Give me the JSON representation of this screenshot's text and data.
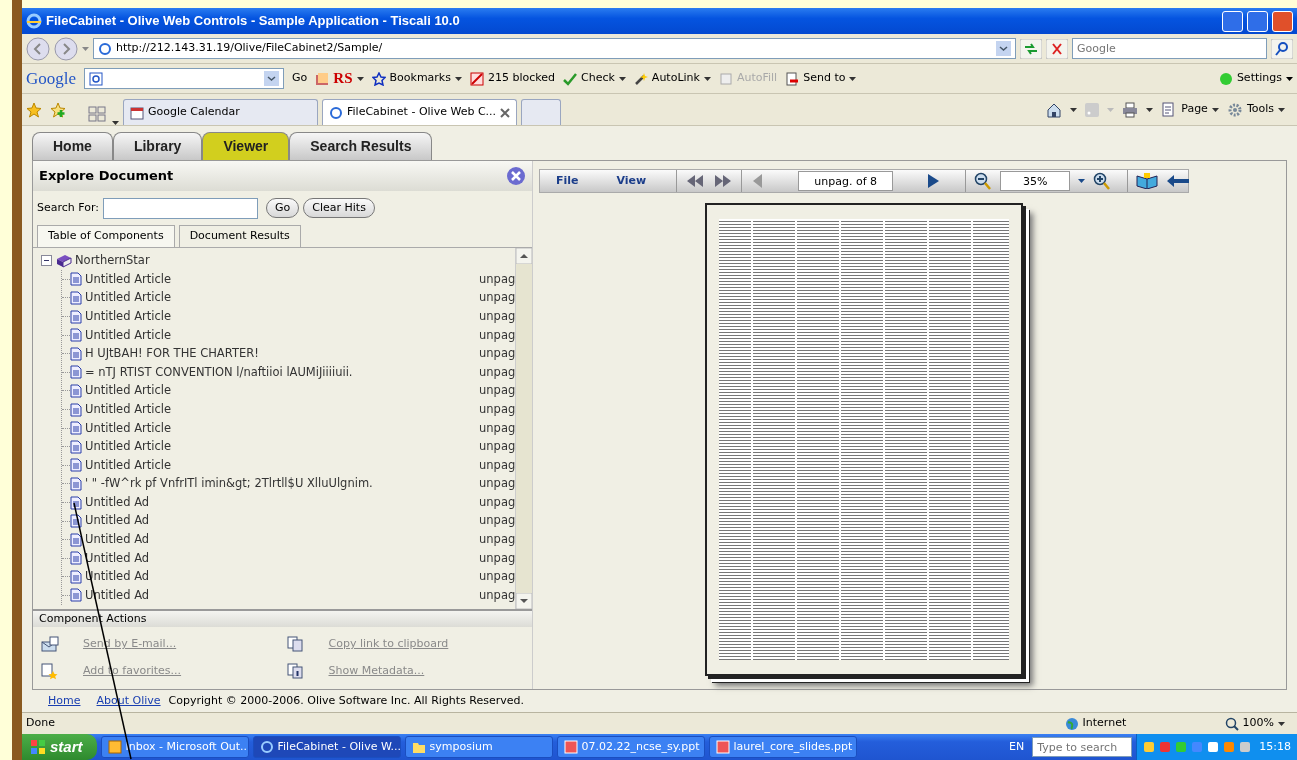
{
  "window": {
    "title": "FileCabinet - Olive Web Controls - Sample Application - Tiscali 10.0"
  },
  "address_bar": {
    "url": "http://212.143.31.19/Olive/FileCabinet2/Sample/",
    "search_placeholder": "Google"
  },
  "google_toolbar": {
    "logo": "Google",
    "items": [
      {
        "label": "Go",
        "menu": false,
        "disabled": false
      },
      {
        "label": "RS",
        "menu": true,
        "disabled": false
      },
      {
        "label": "Bookmarks",
        "menu": true,
        "disabled": false
      },
      {
        "label": "215 blocked",
        "menu": false,
        "disabled": false
      },
      {
        "label": "Check",
        "menu": true,
        "disabled": false
      },
      {
        "label": "AutoLink",
        "menu": true,
        "disabled": false
      },
      {
        "label": "AutoFill",
        "menu": false,
        "disabled": true
      },
      {
        "label": "Send to",
        "menu": true,
        "disabled": false
      }
    ],
    "settings": "Settings"
  },
  "browser_tabs": [
    {
      "label": "Google Calendar",
      "selected": false
    },
    {
      "label": "FileCabinet - Olive Web C...",
      "selected": true
    }
  ],
  "command_bar": {
    "items": [
      "Page",
      "Tools"
    ]
  },
  "app_tabs": [
    {
      "label": "Home",
      "selected": false
    },
    {
      "label": "Library",
      "selected": false
    },
    {
      "label": "Viewer",
      "selected": true
    },
    {
      "label": "Search Results",
      "selected": false
    }
  ],
  "explore": {
    "title": "Explore Document",
    "search_label": "Search For:",
    "go": "Go",
    "clear": "Clear Hits",
    "tabs": [
      {
        "label": "Table of Components",
        "selected": true
      },
      {
        "label": "Document Results",
        "selected": false
      }
    ],
    "tree": {
      "label": "NorthernStar",
      "expanded": true,
      "children": [
        {
          "label": "Untitled Article",
          "page": "unpag"
        },
        {
          "label": "Untitled Article",
          "page": "unpag"
        },
        {
          "label": "Untitled Article",
          "page": "unpag"
        },
        {
          "label": "Untitled Article",
          "page": "unpag"
        },
        {
          "label": "H UJtBAH! FOR THE CHARTER!",
          "page": "unpag"
        },
        {
          "label": "= nTJ RTIST CONVENTION l/naftiioi lAUMiJiiiiuii.",
          "page": "unpag"
        },
        {
          "label": "Untitled Article",
          "page": "unpag"
        },
        {
          "label": "Untitled Article",
          "page": "unpag"
        },
        {
          "label": "Untitled Article",
          "page": "unpag"
        },
        {
          "label": "Untitled Article",
          "page": "unpag"
        },
        {
          "label": "Untitled Article",
          "page": "unpag"
        },
        {
          "label": "' \" -fW^rk pf VnfrITl imin&gt; 2Tlrtll$U XlluUlgnim.",
          "page": "unpag"
        },
        {
          "label": "Untitled Ad",
          "page": "unpag"
        },
        {
          "label": "Untitled Ad",
          "page": "unpag"
        },
        {
          "label": "Untitled Ad",
          "page": "unpag"
        },
        {
          "label": "Untitled Ad",
          "page": "unpag"
        },
        {
          "label": "Untitled Ad",
          "page": "unpag"
        },
        {
          "label": "Untitled Ad",
          "page": "unpag"
        }
      ]
    },
    "actions_title": "Component Actions",
    "actions": [
      {
        "label": "Send by E-mail...",
        "disabled": true
      },
      {
        "label": "Copy link to clipboard",
        "disabled": true
      },
      {
        "label": "Add to favorites...",
        "disabled": true
      },
      {
        "label": "Show Metadata...",
        "disabled": true
      }
    ]
  },
  "viewer": {
    "menus": [
      "File",
      "View"
    ],
    "page_field": "unpag. of 8",
    "zoom": "35%"
  },
  "footer": {
    "links": [
      "Home",
      "About Olive"
    ],
    "copyright": "Copyright © 2000-2006. Olive Software Inc. All Rights Reserved."
  },
  "status_bar": {
    "text": "Done",
    "zone": "Internet",
    "zoom": "100%"
  },
  "taskbar": {
    "start": "start",
    "items": [
      {
        "label": "Inbox - Microsoft Out...",
        "selected": false
      },
      {
        "label": "FileCabinet - Olive W...",
        "selected": true
      },
      {
        "label": "symposium",
        "selected": false
      },
      {
        "label": "07.02.22_ncse_sy.ppt",
        "selected": false
      },
      {
        "label": "laurel_core_slides.ppt",
        "selected": false
      }
    ],
    "language": "EN",
    "search_placeholder": "Type to search",
    "clock": "15:18"
  }
}
